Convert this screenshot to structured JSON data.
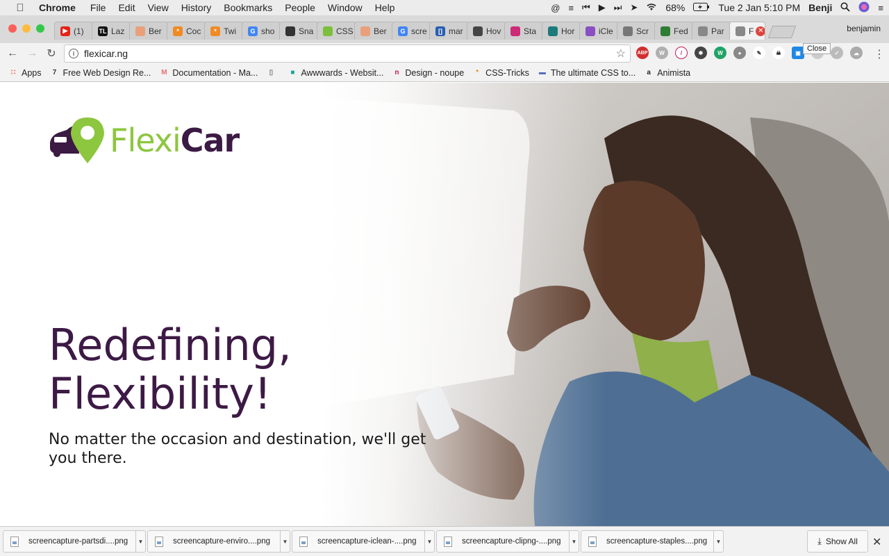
{
  "menubar": {
    "app": "Chrome",
    "items": [
      "File",
      "Edit",
      "View",
      "History",
      "Bookmarks",
      "People",
      "Window",
      "Help"
    ],
    "battery": "68%",
    "datetime": "Tue 2 Jan  5:10 PM",
    "user": "Benji"
  },
  "tabs": [
    {
      "label": "(1)",
      "icon": "youtube-icon",
      "color": "#e62117",
      "glyph": "▶"
    },
    {
      "label": "Laz",
      "icon": "tl-icon",
      "color": "#111111",
      "glyph": "TL"
    },
    {
      "label": "Ber",
      "icon": "person-icon",
      "color": "#e9a07a",
      "glyph": ""
    },
    {
      "label": "Coc",
      "icon": "asterisk-icon",
      "color": "#f08a24",
      "glyph": "*"
    },
    {
      "label": "Twi",
      "icon": "asterisk-icon",
      "color": "#f08a24",
      "glyph": "*"
    },
    {
      "label": "sho",
      "icon": "google-icon",
      "color": "#4285f4",
      "glyph": "G"
    },
    {
      "label": "Sna",
      "icon": "snapshot-icon",
      "color": "#333333",
      "glyph": ""
    },
    {
      "label": "CSS",
      "icon": "css-icon",
      "color": "#7cbf3c",
      "glyph": ""
    },
    {
      "label": "Ber",
      "icon": "person-icon",
      "color": "#e9a07a",
      "glyph": ""
    },
    {
      "label": "scre",
      "icon": "google-icon",
      "color": "#4285f4",
      "glyph": "G"
    },
    {
      "label": "mar",
      "icon": "brackets-icon",
      "color": "#2a5db0",
      "glyph": "[]"
    },
    {
      "label": "Hov",
      "icon": "box-icon",
      "color": "#444444",
      "glyph": ""
    },
    {
      "label": "Sta",
      "icon": "runner-icon",
      "color": "#cc2b77",
      "glyph": ""
    },
    {
      "label": "Hor",
      "icon": "eye-icon",
      "color": "#1d7a7a",
      "glyph": ""
    },
    {
      "label": "iCle",
      "icon": "pen-icon",
      "color": "#8a4fc2",
      "glyph": ""
    },
    {
      "label": "Scr",
      "icon": "camera-icon",
      "color": "#777777",
      "glyph": ""
    },
    {
      "label": "Fed",
      "icon": "seal-icon",
      "color": "#2e7d32",
      "glyph": ""
    },
    {
      "label": "Par",
      "icon": "page-icon",
      "color": "#888888",
      "glyph": ""
    },
    {
      "label": "F",
      "icon": "page-icon",
      "color": "#888888",
      "glyph": "",
      "active": true
    }
  ],
  "profile_name": "benjamin",
  "tooltip": "Close",
  "address": {
    "url": "flexicar.ng"
  },
  "bookmarks": [
    {
      "label": "Apps",
      "icon": "apps-grid-icon"
    },
    {
      "label": "Free Web Design Re...",
      "icon": "bookmark-favicon-icon"
    },
    {
      "label": "Documentation - Ma...",
      "icon": "materialize-icon"
    },
    {
      "label": "",
      "icon": "page-icon"
    },
    {
      "label": "Awwwards - Websit...",
      "icon": "awwwards-icon"
    },
    {
      "label": "Design - noupe",
      "icon": "noupe-icon"
    },
    {
      "label": "CSS-Tricks",
      "icon": "asterisk-icon"
    },
    {
      "label": "The ultimate CSS to...",
      "icon": "css-tool-icon"
    },
    {
      "label": "Animista",
      "icon": "animista-icon"
    }
  ],
  "hero": {
    "logo_flexi": "Flexi",
    "logo_car": "Car",
    "headline_line1": "Redefining,",
    "headline_line2": "Flexibility!",
    "subline": "No matter the occasion and destination, we'll get you there."
  },
  "downloads": [
    {
      "file": "screencapture-partsdi....png"
    },
    {
      "file": "screencapture-enviro....png"
    },
    {
      "file": "screencapture-iclean-....png"
    },
    {
      "file": "screencapture-clipng-....png"
    },
    {
      "file": "screencapture-staples....png"
    }
  ],
  "downloads_show_all": "Show All",
  "colors": {
    "brand_purple": "#3d1a45",
    "brand_green": "#8dc63f"
  }
}
